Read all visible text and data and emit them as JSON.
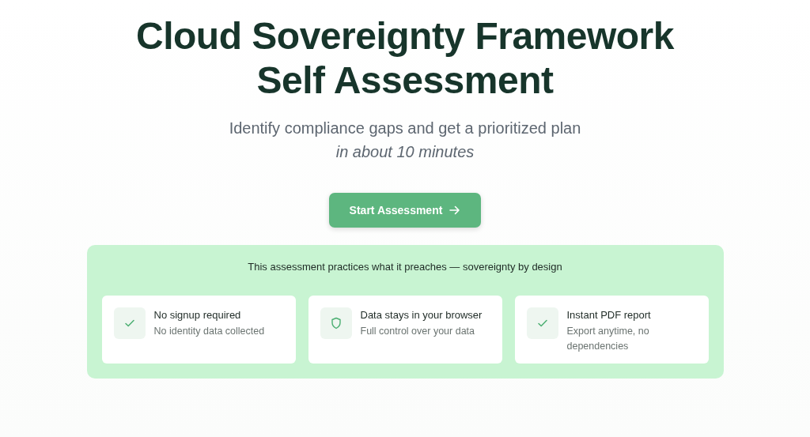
{
  "hero": {
    "title": "Cloud Sovereignty Framework Self Assessment",
    "subtitle": "Identify compliance gaps and get a prioritized plan",
    "subtitle_emphasis": "in about 10 minutes",
    "button": "Start Assessment"
  },
  "panel": {
    "heading": "This assessment practices what it preaches — sovereignty by design",
    "features": [
      {
        "kind": "check",
        "title": "No signup required",
        "description": "No identity data collected"
      },
      {
        "kind": "shield",
        "title": "Data stays in your browser",
        "description": "Full control over your data"
      },
      {
        "kind": "check",
        "title": "Instant PDF report",
        "description": "Export anytime, no dependencies"
      }
    ]
  }
}
